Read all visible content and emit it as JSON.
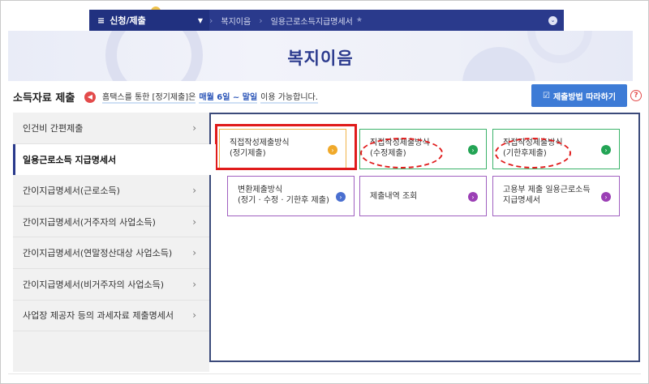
{
  "topnav": {
    "menu_label": "신청/제출",
    "crumbs": [
      "복지이음",
      "일용근로소득지급명세서"
    ]
  },
  "banner": {
    "title": "복지이음"
  },
  "header": {
    "section_title": "소득자료 제출",
    "notice_part1": "홈택스를 통한 [정기제출]은",
    "notice_part2": "매월 6일 ~ 말일",
    "notice_part3": "이용 가능합니다.",
    "follow_button": "제출방법 따라하기"
  },
  "sidebar": {
    "items": [
      {
        "label": "인건비 간편제출"
      },
      {
        "label": "일용근로소득 지급명세서"
      },
      {
        "label": "간이지급명세서(근로소득)"
      },
      {
        "label": "간이지급명세서(거주자의 사업소득)"
      },
      {
        "label": "간이지급명세서(연말정산대상 사업소득)"
      },
      {
        "label": "간이지급명세서(비거주자의 사업소득)"
      },
      {
        "label": "사업장 제공자 등의 과세자료 제출명세서"
      }
    ]
  },
  "cards": [
    {
      "line1": "직접작성제출방식",
      "line2": "(정기제출)",
      "color": "#f0a92a"
    },
    {
      "line1": "직접작성제출방식",
      "line2": "(수정제출)",
      "color": "#23a455"
    },
    {
      "line1": "직접작성제출방식",
      "line2": "(기한후제출)",
      "color": "#23a455"
    },
    {
      "line1": "변환제출방식",
      "line2": "(정기 · 수정 · 기한후 제출)",
      "color": "#4a6fd0"
    },
    {
      "line1": "제출내역 조회",
      "color": "#9b3fb5"
    },
    {
      "line1": "고용부 제출 일용근로소득",
      "line2": "지급명세서",
      "color": "#9b3fb5"
    }
  ],
  "colors": {
    "nav": "#2a3a8c",
    "accent_button": "#3d7bd6",
    "highlight": "#e01b1b"
  }
}
